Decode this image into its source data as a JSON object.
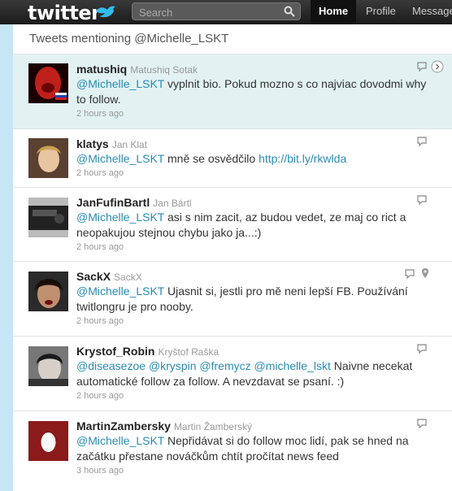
{
  "app": {
    "logo_text": "twitter",
    "search_placeholder": "Search",
    "nav": [
      "Home",
      "Profile",
      "Messages"
    ]
  },
  "panel": {
    "title": "Tweets mentioning @Michelle_LSKT"
  },
  "tweets": [
    {
      "username": "matushiq",
      "fullname": "Matushiq Sotak",
      "parts": [
        {
          "t": "@Michelle_LSKT",
          "link": true
        },
        {
          "t": " vyplnit bio. Pokud mozno s co najviac dovodmi why to follow.",
          "link": false
        }
      ],
      "time": "2 hours ago"
    },
    {
      "username": "klatys",
      "fullname": "Jan Klat",
      "parts": [
        {
          "t": "@Michelle_LSKT",
          "link": true
        },
        {
          "t": " mně se osvědčilo ",
          "link": false
        },
        {
          "t": "http://bit.ly/rkwlda",
          "link": true
        }
      ],
      "time": "2 hours ago"
    },
    {
      "username": "JanFufinBartl",
      "fullname": "Jan Bártl",
      "parts": [
        {
          "t": "@Michelle_LSKT",
          "link": true
        },
        {
          "t": " asi s nim zacit, az budou vedet, ze maj co rict a neopakujou stejnou chybu jako ja...:)",
          "link": false
        }
      ],
      "time": "2 hours ago"
    },
    {
      "username": "SackX",
      "fullname": "SackX",
      "parts": [
        {
          "t": "@Michelle_LSKT",
          "link": true
        },
        {
          "t": " Ujasnit si, jestli pro mě neni lepší FB. Používání twitlongru je pro nooby.",
          "link": false
        }
      ],
      "time": "2 hours ago"
    },
    {
      "username": "Krystof_Robin",
      "fullname": "Kryštof Raška",
      "parts": [
        {
          "t": "@diseasezoe",
          "link": true
        },
        {
          "t": " ",
          "link": false
        },
        {
          "t": "@kryspin",
          "link": true
        },
        {
          "t": " ",
          "link": false
        },
        {
          "t": "@fremycz",
          "link": true
        },
        {
          "t": " ",
          "link": false
        },
        {
          "t": "@michelle_lskt",
          "link": true
        },
        {
          "t": " Naivne necekat automatické follow za follow. A nevzdavat se psaní. :)",
          "link": false
        }
      ],
      "time": "2 hours ago"
    },
    {
      "username": "MartinZambersky",
      "fullname": "Martin Žamberský",
      "parts": [
        {
          "t": "@Michelle_LSKT",
          "link": true
        },
        {
          "t": " Nepřidávat si do follow moc lidí, pak se hned na začátku přestane nováčkům chtít pročítat news feed",
          "link": false
        }
      ],
      "time": "3 hours ago"
    }
  ]
}
